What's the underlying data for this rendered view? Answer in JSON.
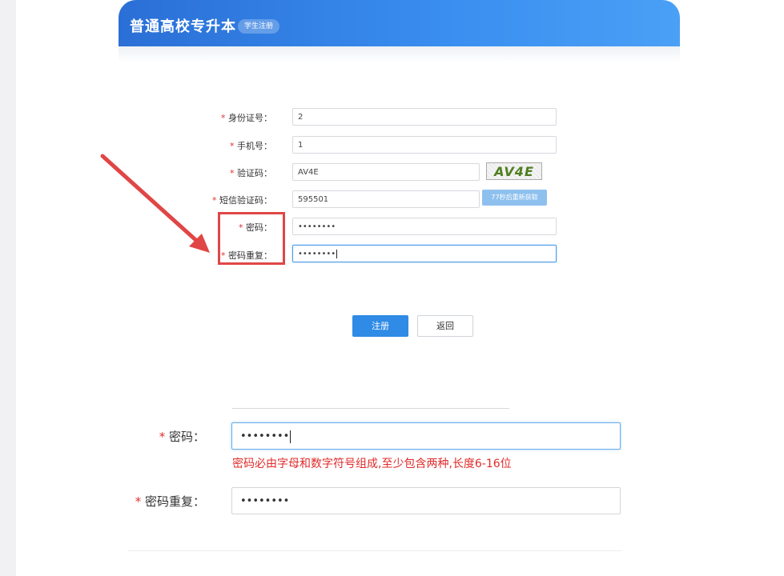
{
  "header": {
    "title": "普通高校专升本",
    "subtitle": "学生注册"
  },
  "form": {
    "id_label": "身份证号：",
    "id_value": "2",
    "phone_label": "手机号：",
    "phone_value": "1",
    "captcha_label": "验证码：",
    "captcha_value": "AV4E",
    "captcha_image_text": "AV4E",
    "sms_label": "短信验证码：",
    "sms_value": "595501",
    "sms_button": "77秒后重新获取",
    "password_label": "密码：",
    "password_value": "••••••••",
    "password_repeat_label": "密码重复：",
    "password_repeat_value": "••••••••",
    "required_mark": "*"
  },
  "buttons": {
    "register": "注册",
    "back": "返回"
  },
  "zoom": {
    "password_label": "密码：",
    "password_value": "••••••••",
    "error_text": "密码必由字母和数字符号组成,至少包含两种,长度6-16位",
    "password_repeat_label": "密码重复：",
    "password_repeat_value": "••••••••",
    "required_mark": "*"
  },
  "colors": {
    "header_blue": "#3a8ff0",
    "annotation_red": "#e04646",
    "error_red": "#e02b2b",
    "primary_button": "#2f8be6"
  }
}
